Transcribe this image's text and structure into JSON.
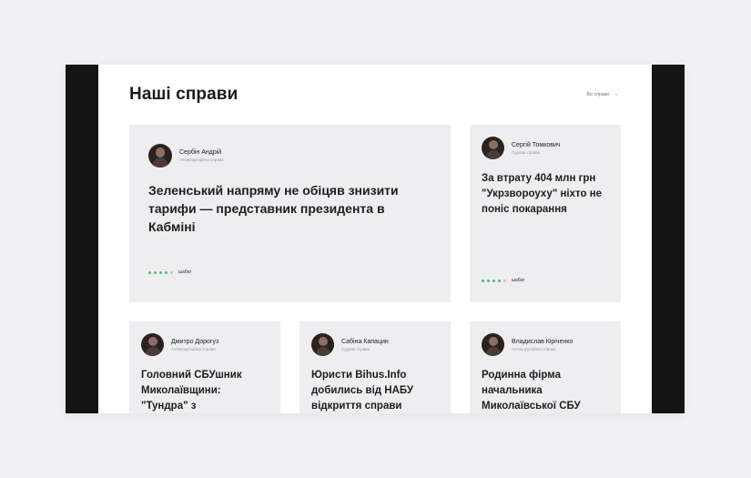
{
  "section": {
    "title": "Наші справи",
    "all_link": "Всі справи",
    "arrow": "→"
  },
  "cards": [
    {
      "author": "Сербін Андрій",
      "category": "Антикорупційна справа",
      "title": "Зеленський напряму не обіцяв знизити тарифи — представник президента в Кабміні",
      "progress_filled": 4,
      "progress_total": 5,
      "status": "шабат"
    },
    {
      "author": "Сергій Томкович",
      "category": "Судова справа",
      "title": "За втрату 404 млн грн \"Укрзвороуху\" ніхто не поніс покарання",
      "progress_filled": 4,
      "progress_total": 5,
      "status": "шабат"
    },
    {
      "author": "Дмитро Дорогуз",
      "category": "Антикорупційна справа",
      "title": "Головний СБУшник Миколаївщини: \"Тундра\" з"
    },
    {
      "author": "Сабіна Капацин",
      "category": "Судова справа",
      "title": "Юристи Bihus.Info добились від НАБУ відкриття справи"
    },
    {
      "author": "Владислав Кіріченко",
      "category": "Антикорупційна справа",
      "title": "Родинна фірма начальника Миколаївської СБУ"
    }
  ],
  "colors": {
    "progress_on": "#45c26a",
    "progress_off": "#c7c7c7",
    "card_bg": "#eeeef1"
  }
}
